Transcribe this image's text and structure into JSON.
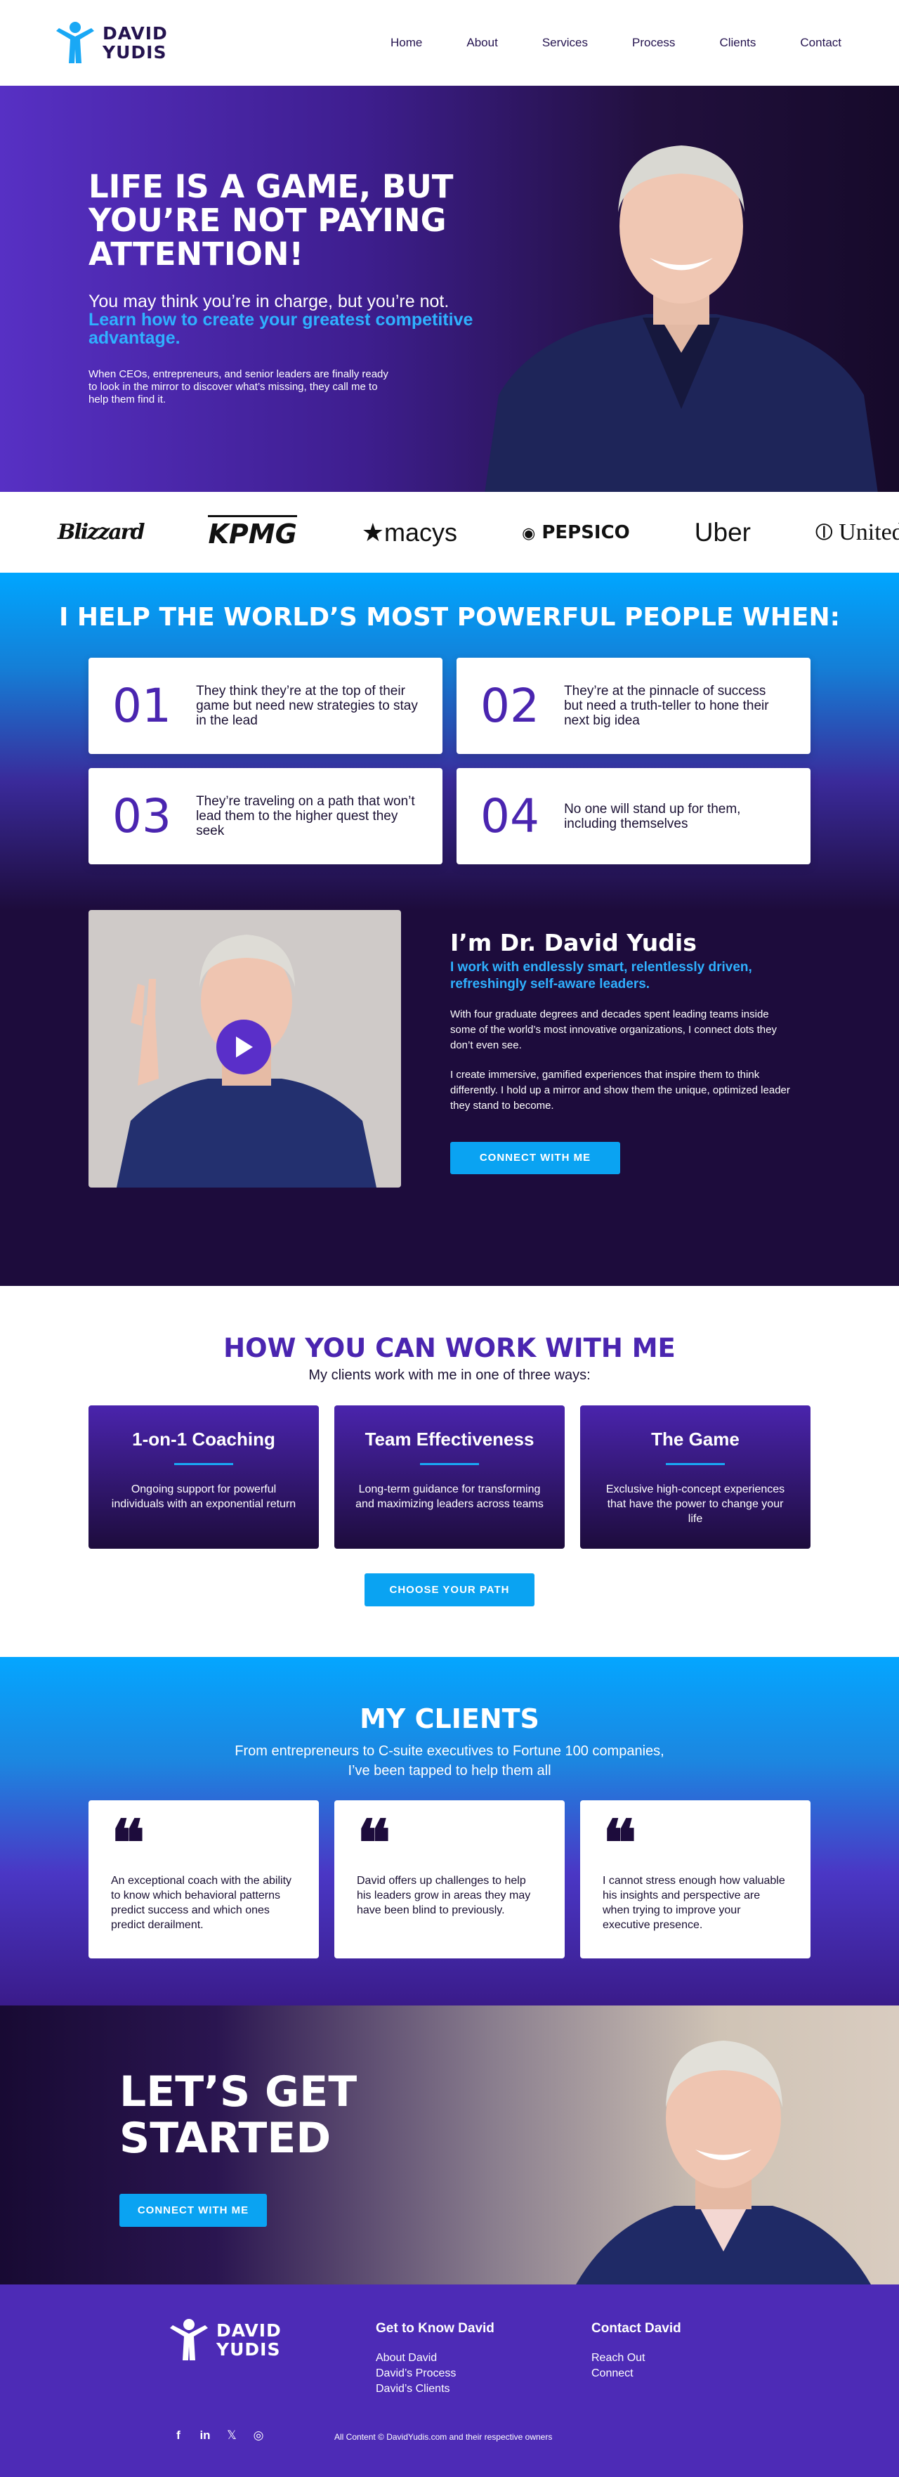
{
  "brand": {
    "name_line1": "DAVID",
    "name_line2": "YUDIS"
  },
  "nav": {
    "items": [
      {
        "label": "Home"
      },
      {
        "label": "About"
      },
      {
        "label": "Services"
      },
      {
        "label": "Process"
      },
      {
        "label": "Clients"
      },
      {
        "label": "Contact"
      }
    ]
  },
  "hero": {
    "title": "Life is a game, but you’re not paying attention!",
    "sub_plain": "You may think you’re in charge, but you’re not.",
    "sub_highlight": "Learn how to create your greatest competitive advantage.",
    "small": "When CEOs, entrepreneurs, and senior leaders are finally ready to look in the mirror to discover what’s missing, they call me to help them find it."
  },
  "clients_logos": [
    {
      "name": "Blizzard"
    },
    {
      "name": "KPMG"
    },
    {
      "name": "macys"
    },
    {
      "name": "PEPSICO"
    },
    {
      "name": "Uber"
    },
    {
      "name": "United"
    }
  ],
  "help": {
    "title": "I HELP THE WORLD’S MOST POWERFUL PEOPLE WHEN:",
    "cards": [
      {
        "num": "01",
        "text": "They think they’re at the top of their game but need new strategies to stay in the lead"
      },
      {
        "num": "02",
        "text": "They’re at the pinnacle of success but need a truth-teller to hone their next big idea"
      },
      {
        "num": "03",
        "text": "They’re traveling on a path that won’t lead them to the higher quest they seek"
      },
      {
        "num": "04",
        "text": "No one will stand up for them, including themselves"
      }
    ]
  },
  "about": {
    "heading": "I’m Dr. David Yudis",
    "highlight": "I work with endlessly smart, relentlessly driven, refreshingly self-aware leaders.",
    "p1": "With four graduate degrees and decades spent leading teams inside some of the world’s most innovative organizations, I connect dots they don’t even see.",
    "p2": "I create immersive, gamified experiences that inspire them to think differently. I hold up a mirror and show them the unique, optimized leader they stand to become.",
    "button": "CONNECT WITH ME"
  },
  "work": {
    "heading": "HOW YOU CAN WORK WITH ME",
    "sub": "My clients work with me in one of three ways:",
    "cards": [
      {
        "title": "1-on-1 Coaching",
        "text": "Ongoing support for powerful individuals with an exponential return"
      },
      {
        "title": "Team Effectiveness",
        "text": "Long-term guidance for transforming and maximizing leaders across teams"
      },
      {
        "title": "The Game",
        "text": "Exclusive high-concept experiences that have the power to change your life"
      }
    ],
    "button": "CHOOSE YOUR PATH"
  },
  "clients": {
    "heading": "MY CLIENTS",
    "sub": "From entrepreneurs to C-suite executives to Fortune 100 companies, I’ve been tapped to help them all",
    "quotes": [
      {
        "text": "An exceptional coach with the ability to know which behavioral patterns predict success and which ones predict derailment."
      },
      {
        "text": "David offers up challenges to help his leaders grow in areas they may have been blind to previously."
      },
      {
        "text": "I cannot stress enough how valuable his insights and perspective are when trying to improve your executive presence."
      }
    ]
  },
  "start": {
    "heading": "LET’S GET STARTED",
    "button": "CONNECT WITH ME"
  },
  "footer": {
    "col1": {
      "title": "Get to Know David",
      "links": [
        {
          "label": "About David"
        },
        {
          "label": "David’s Process"
        },
        {
          "label": "David’s Clients"
        }
      ]
    },
    "col2": {
      "title": "Contact David",
      "links": [
        {
          "label": "Reach Out"
        },
        {
          "label": "Connect"
        }
      ]
    },
    "social": [
      {
        "icon": "facebook-icon",
        "glyph": "f"
      },
      {
        "icon": "linkedin-icon",
        "glyph": "in"
      },
      {
        "icon": "x-icon",
        "glyph": "𝕏"
      },
      {
        "icon": "instagram-icon",
        "glyph": "◎"
      }
    ],
    "copyright": "All Content © DavidYudis.com and their respective owners"
  },
  "colors": {
    "primary": "#4a25b0",
    "accent": "#0aa3f2",
    "dark": "#1d0c3c"
  }
}
